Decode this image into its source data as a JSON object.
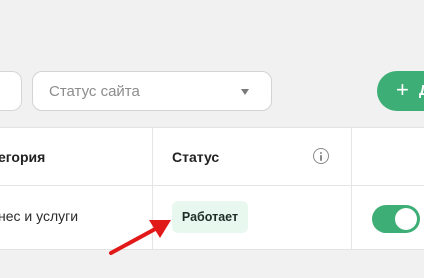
{
  "filters": {
    "status_placeholder": "Статус сайта",
    "add_button_label": "Д",
    "add_button_icon": "+"
  },
  "table": {
    "headers": {
      "category": "егория",
      "status": "Статус"
    },
    "row": {
      "category": "нес и услуги",
      "status_badge": "Работает",
      "toggle_on": true
    }
  },
  "icons": {
    "info": "info-icon",
    "select_caret": "chevron-down-icon",
    "annotation": "red-arrow-icon"
  },
  "colors": {
    "accent_green": "#3dae75",
    "badge_bg": "#e8f8ef",
    "annotation_red": "#e11919"
  }
}
